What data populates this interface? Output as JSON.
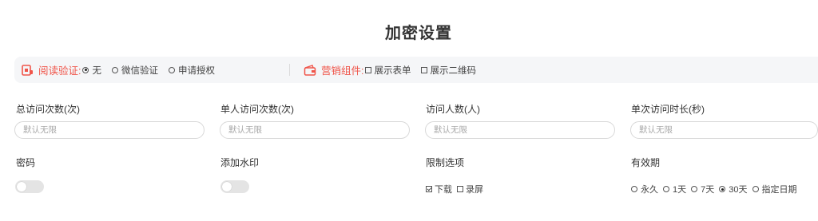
{
  "page": {
    "title": "加密设置"
  },
  "verify": {
    "label": "阅读验证:",
    "options": [
      {
        "label": "无",
        "selected": true
      },
      {
        "label": "微信验证",
        "selected": false
      },
      {
        "label": "申请授权",
        "selected": false
      }
    ]
  },
  "marketing": {
    "label": "营销组件:",
    "options": [
      {
        "label": "展示表单",
        "checked": false
      },
      {
        "label": "展示二维码",
        "checked": false
      }
    ]
  },
  "fields": {
    "total_visits": {
      "label": "总访问次数(次)",
      "placeholder": "默认无限"
    },
    "single_visits": {
      "label": "单人访问次数(次)",
      "placeholder": "默认无限"
    },
    "visitors": {
      "label": "访问人数(人)",
      "placeholder": "默认无限"
    },
    "single_duration": {
      "label": "单次访问时长(秒)",
      "placeholder": "默认无限"
    }
  },
  "password": {
    "label": "密码",
    "enabled": false
  },
  "watermark": {
    "label": "添加水印",
    "enabled": false
  },
  "restrict": {
    "label": "限制选项",
    "options": [
      {
        "label": "下载",
        "checked": true
      },
      {
        "label": "录屏",
        "checked": false
      }
    ]
  },
  "validity": {
    "label": "有效期",
    "options": [
      {
        "label": "永久",
        "selected": false
      },
      {
        "label": "1天",
        "selected": false
      },
      {
        "label": "7天",
        "selected": false
      },
      {
        "label": "30天",
        "selected": true
      },
      {
        "label": "指定日期",
        "selected": false
      }
    ]
  },
  "colors": {
    "accent": "#f0554a",
    "bar_bg": "#f5f6f8",
    "toggle_off": "#e4e4e4"
  }
}
